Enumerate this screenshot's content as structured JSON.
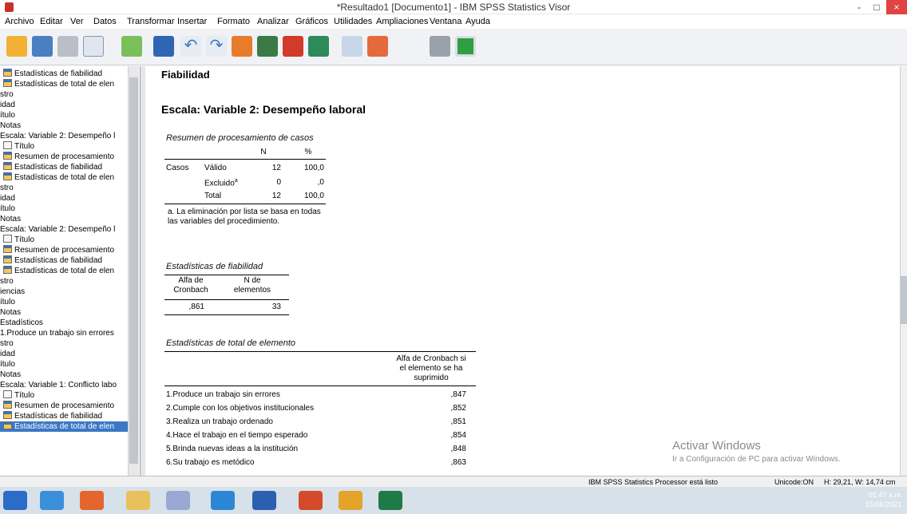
{
  "window": {
    "title": "*Resultado1 [Documento1] - IBM SPSS Statistics Visor",
    "minimize": "-",
    "maximize": "□",
    "close": "×"
  },
  "menu": [
    "Archivo",
    "Editar",
    "Ver",
    "Datos",
    "Transformar",
    "Insertar",
    "Formato",
    "Analizar",
    "Gráficos",
    "Utilidades",
    "Ampliaciones",
    "Ventana",
    "Ayuda"
  ],
  "outline": [
    {
      "label": "Estadísticas de fiabilidad",
      "icon": "table-icon"
    },
    {
      "label": "Estadísticas de total de elen",
      "icon": "table-icon"
    },
    {
      "label": "stro",
      "icon": ""
    },
    {
      "label": "idad",
      "icon": ""
    },
    {
      "label": "ítulo",
      "icon": ""
    },
    {
      "label": "Notas",
      "icon": ""
    },
    {
      "label": "Escala: Variable 2: Desempeño l",
      "icon": ""
    },
    {
      "label": "Título",
      "icon": "title-icon"
    },
    {
      "label": "Resumen de procesamiento",
      "icon": "table-icon"
    },
    {
      "label": "Estadísticas de fiabilidad",
      "icon": "table-icon"
    },
    {
      "label": "Estadísticas de total de elen",
      "icon": "table-icon"
    },
    {
      "label": "stro",
      "icon": ""
    },
    {
      "label": "idad",
      "icon": ""
    },
    {
      "label": "ítulo",
      "icon": ""
    },
    {
      "label": "Notas",
      "icon": ""
    },
    {
      "label": "Escala: Variable 2: Desempeño l",
      "icon": ""
    },
    {
      "label": "Título",
      "icon": "title-icon"
    },
    {
      "label": "Resumen de procesamiento",
      "icon": "table-icon"
    },
    {
      "label": "Estadísticas de fiabilidad",
      "icon": "table-icon"
    },
    {
      "label": "Estadísticas de total de elen",
      "icon": "table-icon"
    },
    {
      "label": "stro",
      "icon": ""
    },
    {
      "label": "iencias",
      "icon": ""
    },
    {
      "label": "ítulo",
      "icon": ""
    },
    {
      "label": "Notas",
      "icon": ""
    },
    {
      "label": "Estadísticos",
      "icon": ""
    },
    {
      "label": "1.Produce un trabajo sin errores",
      "icon": ""
    },
    {
      "label": "stro",
      "icon": ""
    },
    {
      "label": "idad",
      "icon": ""
    },
    {
      "label": "ítulo",
      "icon": ""
    },
    {
      "label": "Notas",
      "icon": ""
    },
    {
      "label": "Escala: Variable 1: Conflicto labo",
      "icon": ""
    },
    {
      "label": "Título",
      "icon": "title-icon"
    },
    {
      "label": "Resumen de procesamiento",
      "icon": "table-icon"
    },
    {
      "label": "Estadísticas de fiabilidad",
      "icon": "table-icon"
    },
    {
      "label": "Estadísticas de total de elen",
      "icon": "table-icon",
      "selected": true
    }
  ],
  "viewer": {
    "heading": "Fiabilidad",
    "subheading": "Escala: Variable 2: Desempeño laboral",
    "case_summary": {
      "caption": "Resumen de procesamiento de casos",
      "col_n": "N",
      "col_pct": "%",
      "group": "Casos",
      "rows": [
        {
          "label": "Válido",
          "n": "12",
          "pct": "100,0"
        },
        {
          "label": "Excluido",
          "sup": "a",
          "n": "0",
          "pct": ",0"
        },
        {
          "label": "Total",
          "n": "12",
          "pct": "100,0"
        }
      ],
      "footnote": "a. La eliminación por lista se basa en todas las variables del procedimiento."
    },
    "reliability": {
      "caption": "Estadísticas de fiabilidad",
      "col_alpha_1": "Alfa de",
      "col_alpha_2": "Cronbach",
      "col_n_1": "N de",
      "col_n_2": "elementos",
      "alpha": ",861",
      "n": "33"
    },
    "item_total": {
      "caption": "Estadísticas de total de elemento",
      "col_header_1": "Alfa de Cronbach si",
      "col_header_2": "el elemento se ha",
      "col_header_3": "suprimido",
      "rows": [
        {
          "label": "1.Produce un trabajo sin errores",
          "value": ",847"
        },
        {
          "label": "2.Cumple con los objetivos institucionales",
          "value": ",852"
        },
        {
          "label": "3.Realiza un trabajo ordenado",
          "value": ",851"
        },
        {
          "label": "4.Hace el trabajo en el tiempo esperado",
          "value": ",854"
        },
        {
          "label": "5.Brinda nuevas ideas a la institución",
          "value": ",848"
        },
        {
          "label": "6.Su trabajo es metódico",
          "value": ",863"
        }
      ]
    }
  },
  "watermark": {
    "line1": "Activar Windows",
    "line2": "Ir a Configuración de PC para activar Windows."
  },
  "status": {
    "processor": "IBM SPSS Statistics Processor está listo",
    "unicode": "Unicode:ON",
    "dims": "H: 29,21, W: 14,74 cm"
  },
  "taskbar": {
    "time": "01:47 a.m.",
    "date": "15/06/2021"
  }
}
